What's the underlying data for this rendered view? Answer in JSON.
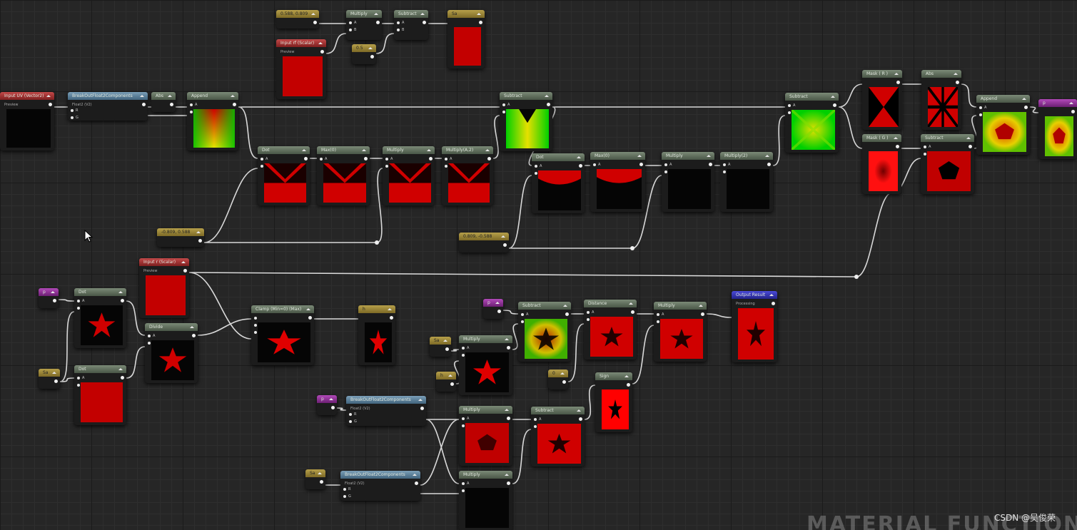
{
  "canvas": {
    "background": "#262626"
  },
  "nodes": [
    {
      "id": "c_top",
      "label": "0.588, 0.809",
      "kind": "const"
    },
    {
      "id": "mul_top",
      "label": "Multiply",
      "kind": "op",
      "pins": [
        "A",
        "B"
      ]
    },
    {
      "id": "sub_top",
      "label": "Subtract",
      "kind": "op",
      "pins": [
        "A",
        "B"
      ]
    },
    {
      "id": "sa_top",
      "label": "Sa",
      "kind": "const"
    },
    {
      "id": "in_rf",
      "label": "Input rf (Scalar)",
      "kind": "input",
      "sub": "Preview"
    },
    {
      "id": "c05",
      "label": "0.5",
      "kind": "const"
    },
    {
      "id": "in_uv",
      "label": "Input UV (Vector2)",
      "kind": "input",
      "sub": "Preview"
    },
    {
      "id": "break_uv",
      "label": "BreakOutFloat2Components",
      "kind": "break",
      "sub": "Float2 (V2)",
      "pins": [
        "R",
        "G"
      ]
    },
    {
      "id": "abs1",
      "label": "Abs",
      "kind": "op"
    },
    {
      "id": "append1",
      "label": "Append",
      "kind": "op",
      "pins": [
        "A",
        "B"
      ]
    },
    {
      "id": "dot1",
      "label": "Dot",
      "kind": "op",
      "pins": [
        "A",
        "B"
      ]
    },
    {
      "id": "max1",
      "label": "Max(0)",
      "kind": "op",
      "pins": [
        "A"
      ]
    },
    {
      "id": "mul1",
      "label": "Multiply",
      "kind": "op",
      "pins": [
        "A",
        "B"
      ]
    },
    {
      "id": "mul2",
      "label": "Multiply(A,2)",
      "kind": "op",
      "pins": [
        "A",
        "B"
      ]
    },
    {
      "id": "sub1",
      "label": "Subtract",
      "kind": "op",
      "pins": [
        "A",
        "B"
      ]
    },
    {
      "id": "dot2",
      "label": "Dot",
      "kind": "op",
      "pins": [
        "A",
        "B"
      ]
    },
    {
      "id": "max2",
      "label": "Max(0)",
      "kind": "op",
      "pins": [
        "A"
      ]
    },
    {
      "id": "mul3",
      "label": "Multiply",
      "kind": "op",
      "pins": [
        "A",
        "B"
      ]
    },
    {
      "id": "mul4",
      "label": "Multiply(2)",
      "kind": "op",
      "pins": [
        "A",
        "B"
      ]
    },
    {
      "id": "c_k1",
      "label": "-0.809, 0.588",
      "kind": "const"
    },
    {
      "id": "c_k2",
      "label": "0.809, -0.588",
      "kind": "const"
    },
    {
      "id": "sub2",
      "label": "Subtract",
      "kind": "op",
      "pins": [
        "A",
        "B"
      ]
    },
    {
      "id": "mask_r",
      "label": "Mask ( R )",
      "kind": "op"
    },
    {
      "id": "abs2",
      "label": "Abs",
      "kind": "op"
    },
    {
      "id": "mask_g",
      "label": "Mask ( G )",
      "kind": "op"
    },
    {
      "id": "sub3",
      "label": "Subtract",
      "kind": "op",
      "pins": [
        "A",
        "B"
      ]
    },
    {
      "id": "append2",
      "label": "Append",
      "kind": "op",
      "pins": [
        "A",
        "B"
      ]
    },
    {
      "id": "p_out",
      "label": "p",
      "kind": "param"
    },
    {
      "id": "in_r",
      "label": "Input r (Scalar)",
      "kind": "input",
      "sub": "Preview"
    },
    {
      "id": "p1",
      "label": "p",
      "kind": "param"
    },
    {
      "id": "sa1",
      "label": "Sa",
      "kind": "const"
    },
    {
      "id": "dot3",
      "label": "Dot",
      "kind": "op",
      "pins": [
        "A",
        "B"
      ]
    },
    {
      "id": "dot4",
      "label": "Dot",
      "kind": "op",
      "pins": [
        "A",
        "B"
      ]
    },
    {
      "id": "divide",
      "label": "Divide",
      "kind": "op",
      "pins": [
        "A",
        "B"
      ]
    },
    {
      "id": "clamp",
      "label": "Clamp (Min=0) (Max)",
      "kind": "op",
      "pins": [
        "",
        "Min",
        "Max"
      ]
    },
    {
      "id": "h_node",
      "label": "h",
      "kind": "const"
    },
    {
      "id": "p2",
      "label": "p",
      "kind": "param"
    },
    {
      "id": "sa2",
      "label": "Sa",
      "kind": "const"
    },
    {
      "id": "h2",
      "label": "h",
      "kind": "const"
    },
    {
      "id": "mul5",
      "label": "Multiply",
      "kind": "op",
      "pins": [
        "A",
        "B"
      ]
    },
    {
      "id": "sub4",
      "label": "Subtract",
      "kind": "op",
      "pins": [
        "A",
        "B"
      ]
    },
    {
      "id": "dist",
      "label": "Distance",
      "kind": "op",
      "pins": [
        "A",
        "B"
      ]
    },
    {
      "id": "mul6",
      "label": "Multiply",
      "kind": "op",
      "pins": [
        "A",
        "B"
      ]
    },
    {
      "id": "output",
      "label": "Output Result",
      "kind": "out",
      "sub": "Processing"
    },
    {
      "id": "c0",
      "label": "0",
      "kind": "const"
    },
    {
      "id": "sign",
      "label": "Sign",
      "kind": "op"
    },
    {
      "id": "p3",
      "label": "p",
      "kind": "param"
    },
    {
      "id": "break2",
      "label": "BreakOutFloat2Components",
      "kind": "break",
      "sub": "Float2 (V2)",
      "pins": [
        "R",
        "G"
      ]
    },
    {
      "id": "mul7",
      "label": "Multiply",
      "kind": "op",
      "pins": [
        "A",
        "B"
      ]
    },
    {
      "id": "sub5",
      "label": "Subtract",
      "kind": "op",
      "pins": [
        "A",
        "B"
      ]
    },
    {
      "id": "sa3",
      "label": "Sa",
      "kind": "const"
    },
    {
      "id": "break3",
      "label": "BreakOutFloat2Components",
      "kind": "break",
      "sub": "Float2 (V2)",
      "pins": [
        "R",
        "G"
      ]
    },
    {
      "id": "mul8",
      "label": "Multiply",
      "kind": "op",
      "pins": [
        "A",
        "B"
      ]
    }
  ],
  "watermark": "MATERIAL FUNCTION",
  "credit": "CSDN @吴俊荣",
  "colors": {
    "wire": "#d9d9d9",
    "red_preview": "#c00000",
    "accent_const": "#b7a04a",
    "accent_input": "#c34a4a",
    "accent_param": "#b24ab9",
    "accent_output": "#4a4ad8"
  }
}
